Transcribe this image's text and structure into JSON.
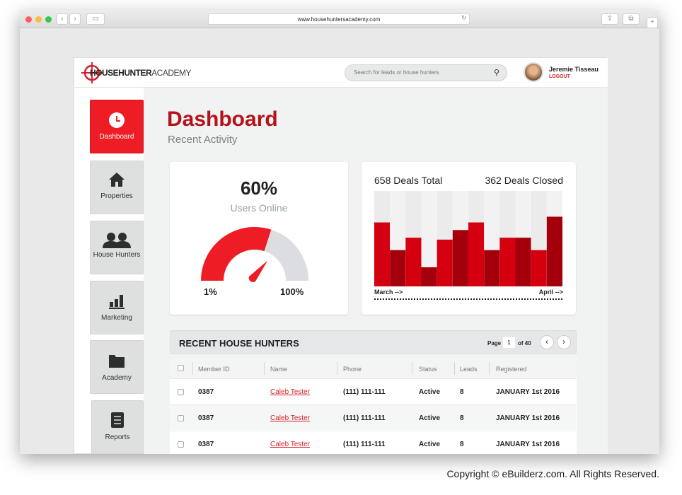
{
  "browser": {
    "url": "www.househuntersacademy.com"
  },
  "header": {
    "logo_bold": "HOUSEHUNTER",
    "logo_thin": "ACADEMY",
    "search_placeholder": "Search for leads or house hunters",
    "user_name": "Jeremie Tisseau",
    "logout": "LOGOUT"
  },
  "sidebar": {
    "items": [
      {
        "label": "Dashboard",
        "icon": "clock-icon",
        "active": true
      },
      {
        "label": "Properties",
        "icon": "house-icon"
      },
      {
        "label": "House Hunters",
        "icon": "users-icon"
      },
      {
        "label": "Marketing",
        "icon": "bar-chart-icon"
      },
      {
        "label": "Academy",
        "icon": "folder-icon"
      },
      {
        "label": "Reports",
        "icon": "document-icon"
      }
    ]
  },
  "main": {
    "title": "Dashboard",
    "subtitle": "Recent Activity"
  },
  "gauge": {
    "value_label": "60%",
    "label": "Users Online",
    "min_label": "1%",
    "max_label": "100%",
    "value": 60
  },
  "deals": {
    "total": "658 Deals Total",
    "closed": "362 Deals Closed",
    "start_label": "March -->",
    "end_label": "April -->"
  },
  "chart_data": {
    "type": "bar",
    "values": [
      67,
      38,
      51,
      20,
      49,
      59,
      67,
      38,
      51,
      51,
      38,
      73
    ],
    "ylim": [
      0,
      100
    ],
    "colors": [
      "#d40010",
      "#a3000c"
    ],
    "background": "#ebebec"
  },
  "table": {
    "title": "RECENT HOUSE HUNTERS",
    "page_label": "Page",
    "page": "1",
    "of_label": "of 40",
    "columns": [
      "Member ID",
      "Name",
      "Phone",
      "Status",
      "Leads",
      "Registered"
    ],
    "rows": [
      [
        "0387",
        "Caleb Tester",
        "(111) 111-111",
        "Active",
        "8",
        "JANUARY 1st 2016"
      ],
      [
        "0387",
        "Caleb Tester",
        "(111) 111-111",
        "Active",
        "8",
        "JANUARY 1st 2016"
      ],
      [
        "0387",
        "Caleb Tester",
        "(111) 111-111",
        "Active",
        "8",
        "JANUARY 1st 2016"
      ]
    ]
  },
  "footer": {
    "copyright": "Copyright © eBuilderz.com. All Rights Reserved."
  },
  "colors": {
    "accent": "#ee1c24",
    "title": "#b5121b"
  }
}
